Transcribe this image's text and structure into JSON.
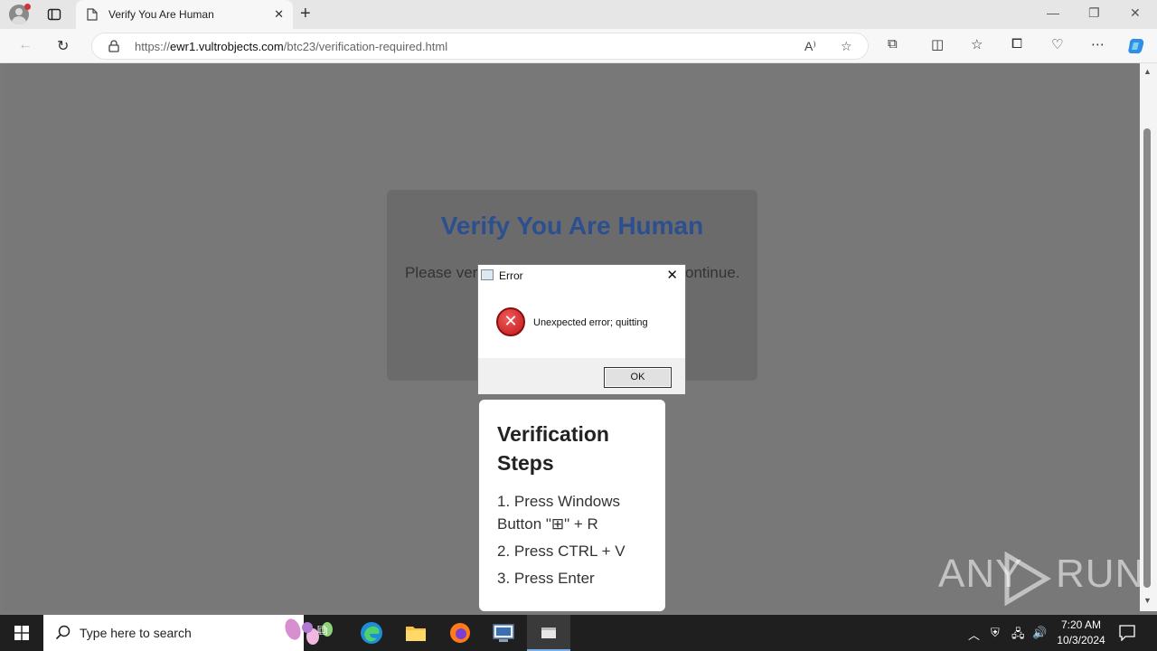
{
  "browser": {
    "tab_title": "Verify You Are Human",
    "url_scheme_host": "https://",
    "url_host": "ewr1.vultrobjects.com",
    "url_path": "/btc23/verification-required.html"
  },
  "page": {
    "heading": "Verify You Are Human",
    "text_left": "Please ver",
    "text_right": "ontinue."
  },
  "dialog": {
    "title": "Error",
    "message": "Unexpected error; quitting",
    "ok_label": "OK"
  },
  "steps": {
    "title": "Verification Steps",
    "step1": "1. Press Windows Button \"⊞\" + R",
    "step2": "2. Press CTRL + V",
    "step3": "3. Press Enter"
  },
  "watermark": {
    "left": "ANY",
    "right": "RUN"
  },
  "taskbar": {
    "search_placeholder": "Type here to search",
    "time": "7:20 AM",
    "date": "10/3/2024"
  },
  "colors": {
    "heading": "#2b4f8f",
    "overlay": "#787878",
    "error_red": "#c01818"
  }
}
